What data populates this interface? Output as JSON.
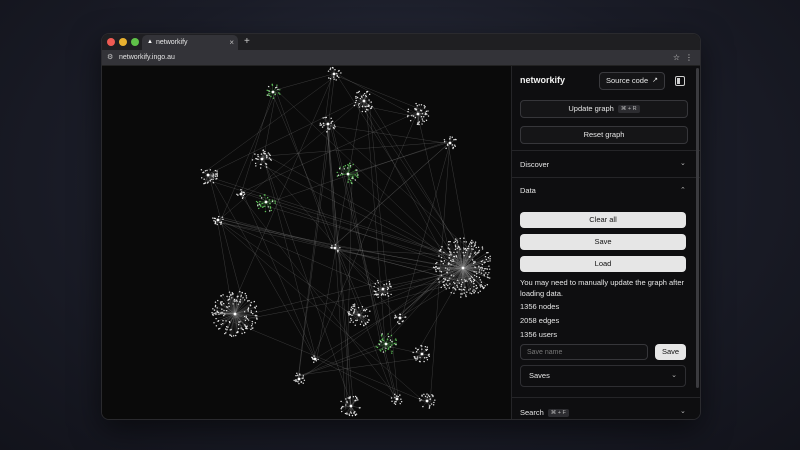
{
  "browser": {
    "tab_title": "networkify",
    "favicon": "triangle-logo-icon",
    "url": "networkify.ingo.au"
  },
  "sidebar": {
    "title": "networkify",
    "source_code_label": "Source code",
    "update_graph_label": "Update graph",
    "update_graph_shortcut": "⌘ + R",
    "reset_graph_label": "Reset graph",
    "discover_label": "Discover",
    "data_label": "Data",
    "clear_all_label": "Clear all",
    "save_label": "Save",
    "load_label": "Load",
    "note": "You may need to manually update the graph after loading data.",
    "nodes": "1356 nodes",
    "edges": "2058 edges",
    "users": "1356 users",
    "save_name_placeholder": "Save name",
    "save_button_label": "Save",
    "saves_label": "Saves",
    "search_label": "Search",
    "search_shortcut": "⌘ + F"
  },
  "colors": {
    "background": "#0a0a0a",
    "node": "#e8e8e8",
    "node_highlight": "#5fc15a",
    "edge": "#8a8a8a"
  }
}
